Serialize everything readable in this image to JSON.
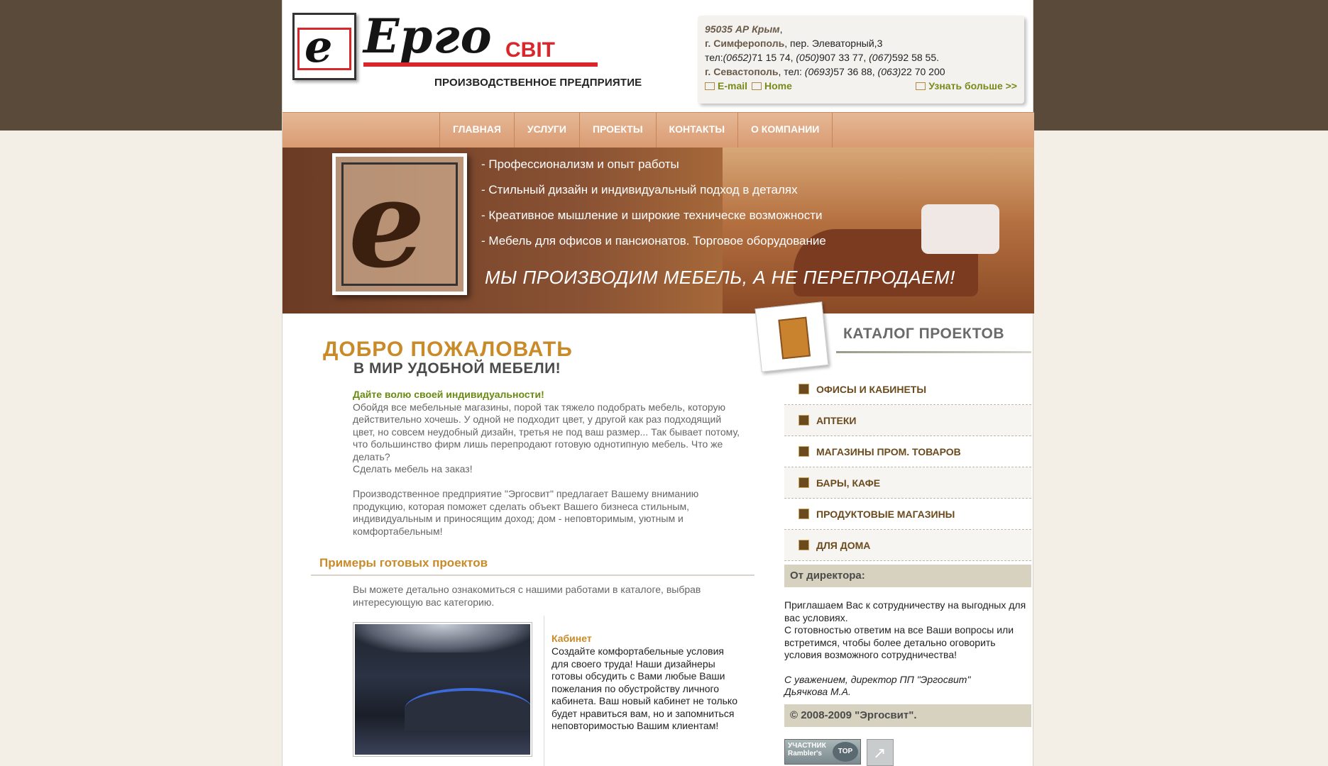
{
  "brand": {
    "name": "Ерго",
    "name_accent": "СВІТ",
    "subtitle": "ПРОИЗВОДСТВЕННОЕ ПРЕДПРИЯТИЕ"
  },
  "contacts": {
    "line1": "95035 АР Крым",
    "line1_suffix": ",",
    "line2_city": "г. Симферополь",
    "line2_rest": ", пер. Элеваторный,3",
    "line3_prefix": "тел:",
    "line3_c1": "(0652)",
    "line3_n1": "71 15 74, ",
    "line3_c2": "(050)",
    "line3_n2": "907 33 77, ",
    "line3_c3": "(067)",
    "line3_n3": "592 58 55.",
    "line4_city": "г. Севастополь",
    "line4_prefix": ", тел: ",
    "line4_c1": "(0693)",
    "line4_n1": "57 36 88, ",
    "line4_c2": "(063)",
    "line4_n2": "22 70 200",
    "email_label": "E-mail",
    "home_label": "Home",
    "more_label": "Узнать больше >>"
  },
  "nav": {
    "items": [
      "ГЛАВНАЯ",
      "УСЛУГИ",
      "ПРОЕКТЫ",
      "КОНТАКТЫ",
      "О КОМПАНИИ"
    ]
  },
  "banner": {
    "lines": [
      "- Профессионализм и опыт работы",
      "- Стильный дизайн и индивидуальный подход в деталях",
      "- Креативное мышление и широкие техническе возможности",
      "- Мебель для офисов и пансионатов. Торговое оборудование"
    ],
    "slogan": "МЫ ПРОИЗВОДИМ МЕБЕЛЬ, А НЕ ПЕРЕПРОДАЕМ!"
  },
  "welcome": {
    "title": "ДОБРО ПОЖАЛОВАТЬ",
    "subtitle": "В МИР УДОБНОЙ МЕБЕЛИ!",
    "headline": "Дайте волю своей индивидуальности!",
    "p1": "Обойдя все мебельные магазины, порой так тяжело подобрать мебель, которую действительно хочешь. У одной не подходит цвет, у другой как раз подходящий цвет, но совсем неудобный дизайн, третья не под ваш размер... Так бывает потому, что большинство фирм лишь перепродают готовую однотипную мебель. Что же делать?",
    "p2": "Сделать мебель на заказ!",
    "p3": "Производственное предприятие \"Эргосвит\" предлагает Вашему вниманию продукцию, которая поможет сделать объект Вашего бизнеса стильным, индивидуальным и приносящим доход; дом - неповторимым, уютным и комфортабельным!"
  },
  "examples": {
    "title": "Примеры готовых проектов",
    "text": "Вы можете детально ознакомиться с нашими работами в каталоге, выбрав интересующую вас категорию.",
    "project_title": "Кабинет",
    "project_desc": "Создайте комфортабельные условия для своего труда! Наши дизайнеры готовы обсудить с Вами любые Ваши пожелания по обустройству личного кабинета. Ваш новый кабинет не только будет нравиться вам, но и запомниться неповторимостью Вашим клиентам!"
  },
  "catalog": {
    "title": "КАТАЛОГ ПРОЕКТОВ",
    "items": [
      "ОФИСЫ И КАБИНЕТЫ",
      "АПТЕКИ",
      "МАГАЗИНЫ ПРОМ. ТОВАРОВ",
      "БАРЫ, КАФЕ",
      "ПРОДУКТОВЫЕ МАГАЗИНЫ",
      "ДЛЯ ДОМА"
    ]
  },
  "director": {
    "title": "От директора:",
    "p1": "Приглашаем Вас к сотрудничеству на выгодных для вас условиях.",
    "p2": "С готовностью ответим на все Ваши вопросы или встретимся, чтобы более детально оговорить условия возможного сотрудничества!",
    "sign1": "С уважением, директор ПП \"Эргосвит\"",
    "sign2": "Дьячкова М.А."
  },
  "footer": {
    "copyright": "© 2008-2009 \"Эргосвит\"."
  },
  "counters": {
    "rambler_label": "УЧАСТНИК Rambler's",
    "rambler_badge": "TOP 100"
  },
  "colors": {
    "top_band": "#5a4a3a",
    "nav": "#d99b72",
    "accent_orange": "#c98a28",
    "green": "#6a8a10",
    "catalog_text": "#6b4a1e"
  }
}
